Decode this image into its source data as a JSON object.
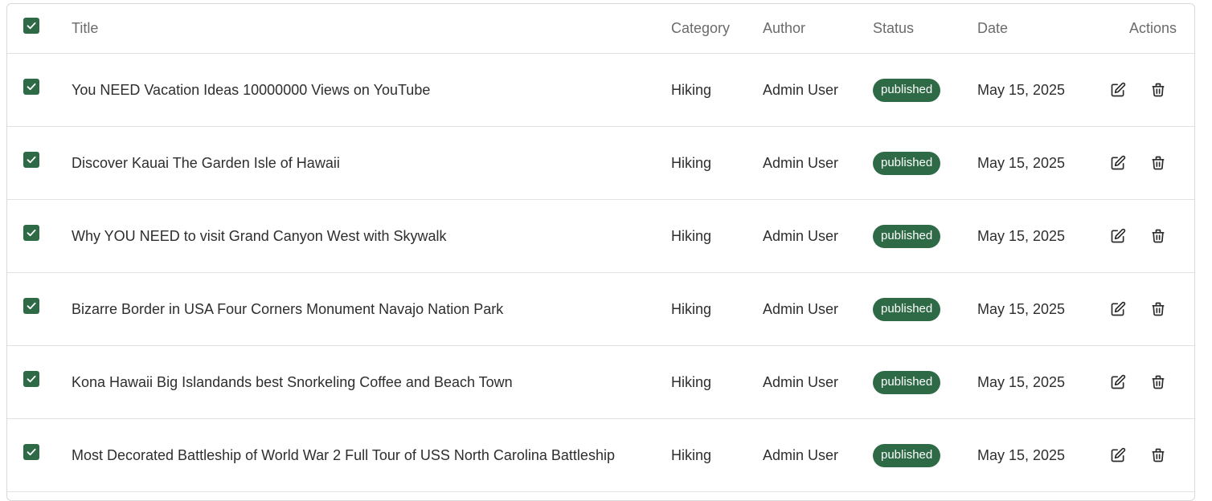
{
  "header": {
    "title": "Title",
    "category": "Category",
    "author": "Author",
    "status": "Status",
    "date": "Date",
    "actions": "Actions"
  },
  "rows": [
    {
      "title": "You NEED Vacation Ideas 10000000 Views on YouTube",
      "category": "Hiking",
      "author": "Admin User",
      "status": "published",
      "date": "May 15, 2025",
      "checked": true
    },
    {
      "title": "Discover Kauai The Garden Isle of Hawaii",
      "category": "Hiking",
      "author": "Admin User",
      "status": "published",
      "date": "May 15, 2025",
      "checked": true
    },
    {
      "title": "Why YOU NEED to visit Grand Canyon West with Skywalk",
      "category": "Hiking",
      "author": "Admin User",
      "status": "published",
      "date": "May 15, 2025",
      "checked": true
    },
    {
      "title": "Bizarre Border in USA Four Corners Monument Navajo Nation Park",
      "category": "Hiking",
      "author": "Admin User",
      "status": "published",
      "date": "May 15, 2025",
      "checked": true
    },
    {
      "title": "Kona Hawaii Big Islandands best Snorkeling Coffee and Beach Town",
      "category": "Hiking",
      "author": "Admin User",
      "status": "published",
      "date": "May 15, 2025",
      "checked": true
    },
    {
      "title": "Most Decorated Battleship of World War 2 Full Tour of USS North Carolina Battleship",
      "category": "Hiking",
      "author": "Admin User",
      "status": "published",
      "date": "May 15, 2025",
      "checked": true
    }
  ],
  "icons": {
    "checkbox": "check-icon",
    "edit": "edit-icon",
    "delete": "trash-icon"
  },
  "colors": {
    "accent": "#2d6a45",
    "badge_text": "#ffffff",
    "border": "#e2e2e2"
  }
}
